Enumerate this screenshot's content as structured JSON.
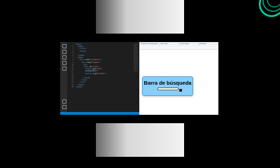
{
  "colors": {
    "editor_bg": "#1e1e1e",
    "status_bar": "#007acc",
    "card_bg": "#87cefa",
    "logo_accent": "#00d4aa"
  },
  "browser": {
    "tabs": [
      "Formulario de Búsqueda",
      "index.html",
      "Lorem Ipsum",
      "Buscador"
    ]
  },
  "page": {
    "search_title": "Barra de búsqueda"
  },
  "icons": {
    "activity": [
      "files-icon",
      "search-icon",
      "source-control-icon",
      "debug-icon",
      "extensions-icon",
      "account-icon",
      "settings-icon"
    ],
    "logo": "circular-logo-icon"
  }
}
